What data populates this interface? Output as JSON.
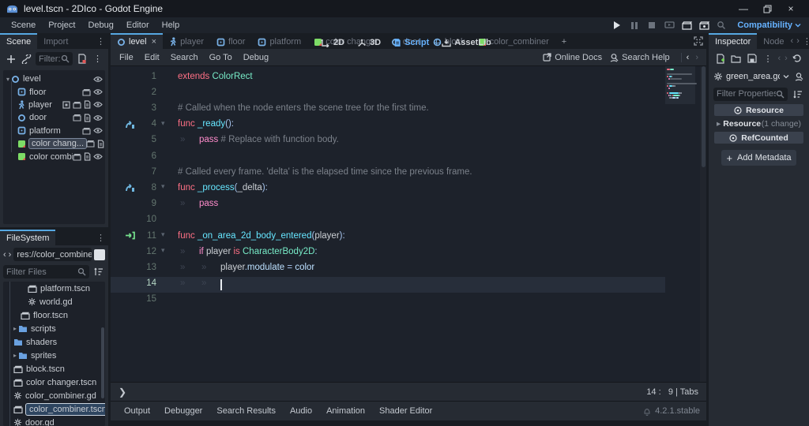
{
  "window": {
    "title": "level.tscn - 2DIco - Godot Engine"
  },
  "menubar": {
    "items": [
      "Scene",
      "Project",
      "Debug",
      "Editor",
      "Help"
    ]
  },
  "workspaces": {
    "items": [
      {
        "label": "2D",
        "icon": "ws-2d",
        "active": false
      },
      {
        "label": "3D",
        "icon": "ws-3d",
        "active": false
      },
      {
        "label": "Script",
        "icon": "ws-script",
        "active": true
      },
      {
        "label": "AssetLib",
        "icon": "ws-assetlib",
        "active": false
      }
    ]
  },
  "playbar": {
    "renderer": "Compatibility"
  },
  "scene_tabs": {
    "tabs": [
      {
        "label": "level",
        "icon": "node-circle",
        "active": true,
        "closable": true
      },
      {
        "label": "player",
        "icon": "node-person",
        "active": false
      },
      {
        "label": "floor",
        "icon": "node-square",
        "active": false
      },
      {
        "label": "platform",
        "icon": "node-square",
        "active": false
      },
      {
        "label": "color changer",
        "icon": "node-colorrect",
        "active": false
      },
      {
        "label": "door",
        "icon": "node-circle",
        "active": false
      },
      {
        "label": "block",
        "icon": "node-sphere",
        "active": false
      },
      {
        "label": "color_combiner",
        "icon": "node-colorrect",
        "active": false
      }
    ],
    "add_label": "+"
  },
  "scene_dock": {
    "tabs": [
      "Scene",
      "Import"
    ],
    "filter_text": "Filter: na",
    "tree": [
      {
        "name": "level",
        "icon": "node-circle",
        "depth": 0,
        "expanded": true,
        "buttons": [
          "eye"
        ]
      },
      {
        "name": "floor",
        "icon": "node-square",
        "depth": 1,
        "buttons": [
          "movie",
          "eye"
        ]
      },
      {
        "name": "player",
        "icon": "node-person",
        "depth": 1,
        "buttons": [
          "frame",
          "movie",
          "script",
          "eye"
        ]
      },
      {
        "name": "door",
        "icon": "node-circle",
        "depth": 1,
        "buttons": [
          "movie",
          "script",
          "eye"
        ]
      },
      {
        "name": "platform",
        "icon": "node-square",
        "depth": 1,
        "buttons": [
          "movie",
          "eye"
        ]
      },
      {
        "name": "color chang...",
        "icon": "node-colorrect",
        "depth": 1,
        "selected": true,
        "buttons": [
          "movie",
          "script",
          "eye"
        ]
      },
      {
        "name": "color combi...",
        "icon": "node-colorrect",
        "depth": 1,
        "buttons": [
          "movie",
          "script",
          "eye"
        ]
      }
    ]
  },
  "filesystem": {
    "title": "FileSystem",
    "path": "res://color_combiner.t",
    "filter_placeholder": "Filter Files",
    "files": [
      {
        "name": "platform.tscn",
        "icon": "file-scene",
        "depth": 3
      },
      {
        "name": "world.gd",
        "icon": "file-gear",
        "depth": 3
      },
      {
        "name": "floor.tscn",
        "icon": "file-scene",
        "depth": 2
      },
      {
        "name": "scripts",
        "icon": "folder",
        "depth": 1,
        "arrow": true
      },
      {
        "name": "shaders",
        "icon": "folder",
        "depth": 1
      },
      {
        "name": "sprites",
        "icon": "folder",
        "depth": 1,
        "arrow": true
      },
      {
        "name": "block.tscn",
        "icon": "file-scene",
        "depth": 1
      },
      {
        "name": "color changer.tscn",
        "icon": "file-scene",
        "depth": 1
      },
      {
        "name": "color_combiner.gd",
        "icon": "file-gear",
        "depth": 1
      },
      {
        "name": "color_combiner.tscn",
        "icon": "file-scene",
        "depth": 1,
        "selected": true
      },
      {
        "name": "door.gd",
        "icon": "file-gear",
        "depth": 1
      }
    ]
  },
  "script_editor": {
    "menus": [
      "File",
      "Edit",
      "Search",
      "Go To",
      "Debug"
    ],
    "online_docs": "Online Docs",
    "search_help": "Search Help",
    "status": {
      "line": "14",
      "col": "9",
      "indent": "Tabs"
    },
    "code": [
      {
        "n": "1",
        "tokens": [
          [
            "extends",
            "kw"
          ],
          [
            " ",
            "tx"
          ],
          [
            "ColorRect",
            "ty"
          ]
        ]
      },
      {
        "n": "2",
        "tokens": []
      },
      {
        "n": "3",
        "tokens": [
          [
            "# Called when the node enters the scene tree for the first time.",
            "cm"
          ]
        ]
      },
      {
        "n": "4",
        "gutter": "override",
        "fold": true,
        "tokens": [
          [
            "func",
            "kw"
          ],
          [
            " ",
            "tx"
          ],
          [
            "_ready",
            "fn"
          ],
          [
            "():",
            "sy"
          ]
        ]
      },
      {
        "n": "5",
        "tabs": 1,
        "tokens": [
          [
            "pass",
            "cf"
          ],
          [
            " ",
            "tx"
          ],
          [
            "# Replace with function body.",
            "cm"
          ]
        ]
      },
      {
        "n": "6",
        "tokens": []
      },
      {
        "n": "7",
        "tokens": [
          [
            "# Called every frame. 'delta' is the elapsed time since the previous frame.",
            "cm"
          ]
        ]
      },
      {
        "n": "8",
        "gutter": "override",
        "fold": true,
        "tokens": [
          [
            "func",
            "kw"
          ],
          [
            " ",
            "tx"
          ],
          [
            "_process",
            "fn"
          ],
          [
            "(",
            "sy"
          ],
          [
            "_delta",
            "tx"
          ],
          [
            "):",
            "sy"
          ]
        ]
      },
      {
        "n": "9",
        "tabs": 1,
        "tokens": [
          [
            "pass",
            "cf"
          ]
        ]
      },
      {
        "n": "10",
        "tokens": []
      },
      {
        "n": "11",
        "gutter": "signal",
        "fold": true,
        "tokens": [
          [
            "func",
            "kw"
          ],
          [
            " ",
            "tx"
          ],
          [
            "_on_area_2d_body_entered",
            "fn"
          ],
          [
            "(",
            "sy"
          ],
          [
            "player",
            "tx"
          ],
          [
            "):",
            "sy"
          ]
        ]
      },
      {
        "n": "12",
        "fold": true,
        "tabs": 1,
        "tokens": [
          [
            "if",
            "cf"
          ],
          [
            " ",
            "tx"
          ],
          [
            "player",
            "tx"
          ],
          [
            " ",
            "tx"
          ],
          [
            "is",
            "kw"
          ],
          [
            " ",
            "tx"
          ],
          [
            "CharacterBody2D",
            "ty"
          ],
          [
            ":",
            "sy"
          ]
        ]
      },
      {
        "n": "13",
        "tabs": 2,
        "tokens": [
          [
            "player",
            "tx"
          ],
          [
            ".",
            "sy"
          ],
          [
            "modulate",
            "mb"
          ],
          [
            " ",
            "tx"
          ],
          [
            "=",
            "sy"
          ],
          [
            " ",
            "tx"
          ],
          [
            "color",
            "mb"
          ]
        ]
      },
      {
        "n": "14",
        "tabs": 2,
        "current": true,
        "caret": true,
        "tokens": []
      },
      {
        "n": "15",
        "tokens": []
      }
    ]
  },
  "inspector": {
    "tabs": [
      "Inspector",
      "Node"
    ],
    "file": "green_area.gd",
    "filter_placeholder": "Filter Properties",
    "resource_section": "Resource",
    "resource_row": {
      "label": "Resource",
      "badge": "(1 change)"
    },
    "refcounted_section": "RefCounted",
    "add_metadata": "Add Metadata"
  },
  "bottom_bar": {
    "tabs": [
      "Output",
      "Debugger",
      "Search Results",
      "Audio",
      "Animation",
      "Shader Editor"
    ],
    "version": "4.2.1.stable"
  },
  "colors": {
    "accent": "#66b2ff",
    "keyword": "#ff7085",
    "control_flow": "#ff8ccc",
    "base_type": "#78ecc8",
    "function_def": "#66e6ff",
    "member": "#bce0ff",
    "text": "#ccd0d5",
    "comment": "#7b818a",
    "symbol": "#a9c7f0",
    "node_blue": "#79b2e8",
    "node_green": "#7ddc66",
    "folder_blue": "#6aa1e0"
  }
}
